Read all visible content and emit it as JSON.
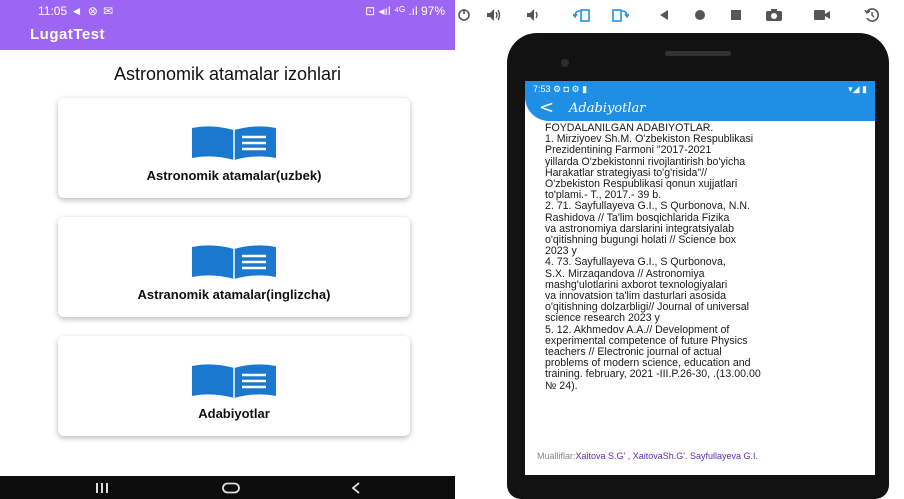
{
  "left": {
    "status_bar": {
      "time": "11:05",
      "indicators": "◄ ⊗ ✉",
      "right": "⊡ ◂ıl ⁴ᴳ .ıl 97%"
    },
    "app_title": "LugatTest",
    "heading": "Astronomik atamalar izohlari",
    "cards": [
      {
        "label": "Astronomik atamalar(uzbek)",
        "icon": "book-icon"
      },
      {
        "label": "Astranomik atamalar(inglizcha)",
        "icon": "book-icon"
      },
      {
        "label": "Adabiyotlar",
        "icon": "book-icon"
      }
    ],
    "nav": {
      "recents": "|||",
      "home": "◯",
      "back": "<"
    }
  },
  "right": {
    "toolbar_icons": [
      "power-icon",
      "volume-up-icon",
      "volume-down-icon",
      "rotate-left-icon",
      "rotate-right-icon",
      "back-icon",
      "home-icon",
      "overview-icon",
      "screenshot-icon",
      "camera-icon",
      "replay-icon"
    ],
    "status_bar": {
      "time": "7:53",
      "icons": "⚙ ◘ ⚙ ▮",
      "right": "▾◢ ▮"
    },
    "back_arrow": "<",
    "title": "Adabiyotlar",
    "lines": [
      "FOYDALANILGAN ADABIYOTLAR.",
      "1. Mirziyoev Sh.M. O'zbekiston Respublikasi",
      "Prezidentining Farmoni \"2017-2021",
      "yillarda O'zbekistonni rivojlantirish bo'yicha",
      "Harakatlar strategiyasi to'g'risida\"//",
      "O'zbekiston Respublikasi qonun xujjatlari",
      "to'plami.- T., 2017.- 39 b.",
      "2. 71. Sayfullayeva G.I., S Qurbonova, N.N.",
      "Rashidova // Ta'lim bosqichlarida Fizika",
      "va astronomiya darslarini integratsiyalab",
      "o'qitishning bugungi holati // Science box",
      "2023 y",
      "4. 73. Sayfullayeva G.I., S Qurbonova,",
      "S.X. Mirzaqandova // Astronomiya",
      "mashg'ulotlarini axborot texnologiyalari",
      "va innovatsion ta'lim dasturlari asosida",
      "o'qitishning dolzarbligi// Journal of universal",
      "science research 2023 y",
      "5. 12. Akhmedov A.A.// Development of",
      "experimental competence of future Physics",
      "teachers // Electronic journal of actual",
      "problems of modern science, education and",
      "training. february, 2021 -III.P.26-30, .(13.00.00",
      "№ 24)."
    ],
    "authors_label": "Mualliflar:",
    "authors_names": "Xaitova S.G' , XaitovaSh.G'. Sayfullayeva G.I."
  },
  "colors": {
    "left_accent": "#9d66f2",
    "right_accent": "#1f8fe5",
    "book_blue": "#1b78cf"
  }
}
